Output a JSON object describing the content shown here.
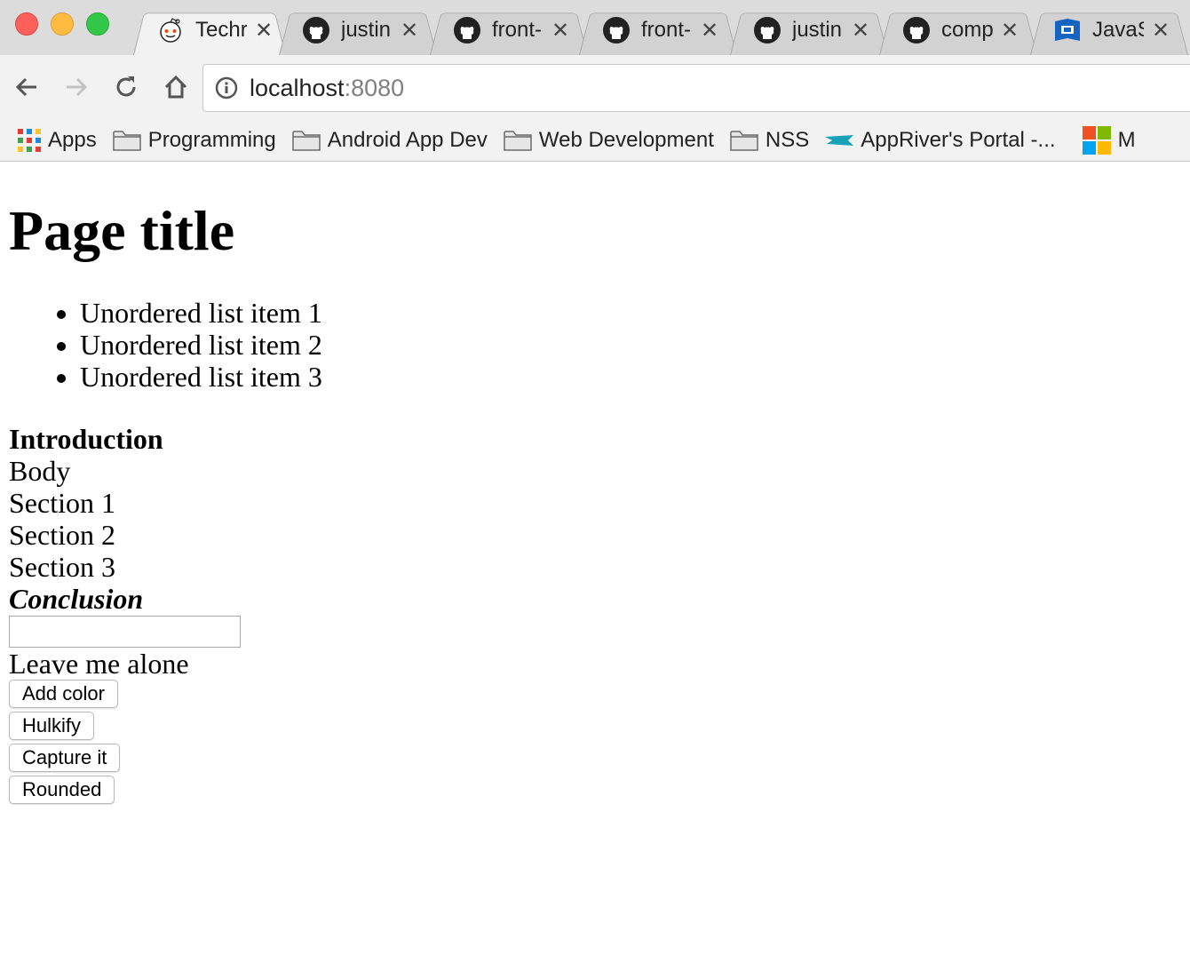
{
  "browser": {
    "tabs": [
      {
        "label": "Techr",
        "icon": "reddit-icon"
      },
      {
        "label": "justin",
        "icon": "github-icon"
      },
      {
        "label": "front-",
        "icon": "github-icon"
      },
      {
        "label": "front-",
        "icon": "github-icon"
      },
      {
        "label": "justin",
        "icon": "github-icon"
      },
      {
        "label": "comp",
        "icon": "github-icon"
      },
      {
        "label": "JavaS",
        "icon": "javascript-book-icon"
      }
    ],
    "address": {
      "host": "localhost",
      "port": ":8080"
    },
    "bookmarks": [
      {
        "label": "Apps",
        "icon": "apps-grid-icon"
      },
      {
        "label": "Programming",
        "icon": "folder-icon"
      },
      {
        "label": "Android App Dev",
        "icon": "folder-icon"
      },
      {
        "label": "Web Development",
        "icon": "folder-icon"
      },
      {
        "label": "NSS",
        "icon": "folder-icon"
      },
      {
        "label": "AppRiver's Portal -...",
        "icon": "appriver-icon"
      },
      {
        "label": "M",
        "icon": "microsoft-icon"
      }
    ]
  },
  "page": {
    "title": "Page title",
    "list_items": [
      "Unordered list item 1",
      "Unordered list item 2",
      "Unordered list item 3"
    ],
    "introduction": "Introduction",
    "body": "Body",
    "sections": [
      "Section 1",
      "Section 2",
      "Section 3"
    ],
    "conclusion": "Conclusion",
    "input_value": "",
    "leave_text": "Leave me alone",
    "buttons": [
      "Add color",
      "Hulkify",
      "Capture it",
      "Rounded"
    ]
  }
}
